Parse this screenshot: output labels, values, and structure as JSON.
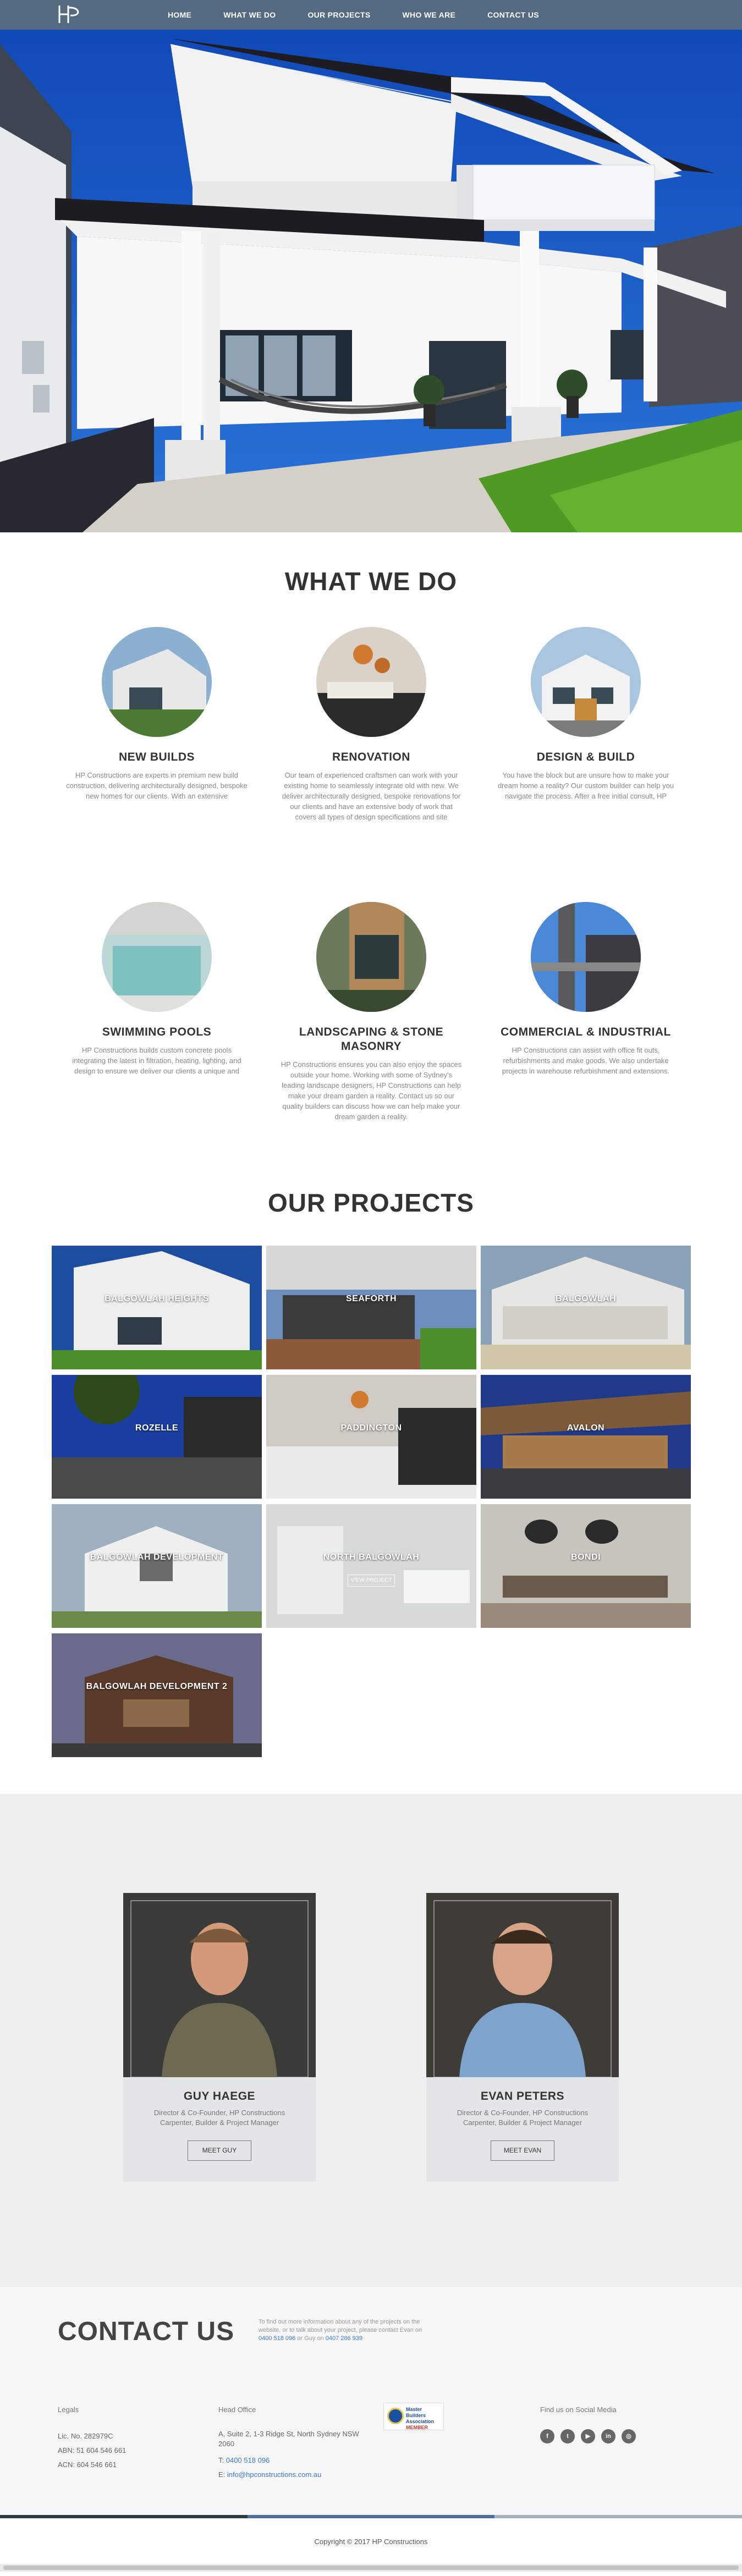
{
  "nav": {
    "logo": "HP",
    "items": [
      "HOME",
      "WHAT WE DO",
      "OUR PROJECTS",
      "WHO WE ARE",
      "CONTACT US"
    ]
  },
  "colors": {
    "nav_bg": "#5a6e7d",
    "stripe_dark": "#2e3b47",
    "stripe_blue": "#4b6f96",
    "stripe_grey": "#a7b4c0",
    "link_blue": "#3a7bd5"
  },
  "what_we_do": {
    "title": "WHAT WE DO",
    "services": [
      {
        "title": "NEW BUILDS",
        "text": "HP Constructions are experts in premium new build construction, delivering architecturally designed, bespoke new homes for our clients. With an extensive"
      },
      {
        "title": "RENOVATION",
        "text": "Our team of experienced craftsmen can work with your existing home to seamlessly integrate old with new. We deliver architecturally designed, bespoke renovations for our clients and have an extensive body of work that covers all types of design specifications and site"
      },
      {
        "title": "DESIGN & BUILD",
        "text": "You have the block but are unsure how to make your dream home a reality? Our custom builder can help you navigate the process. After a free initial consult, HP"
      },
      {
        "title": "SWIMMING POOLS",
        "text": "HP Constructions builds custom concrete pools integrating the latest in filtration, heating, lighting, and design to ensure we deliver our clients a unique and"
      },
      {
        "title": "LANDSCAPING & STONE MASONRY",
        "text": "HP Constructions ensures you can also enjoy the spaces outside your home. Working with some of Sydney's leading landscape designers, HP Constructions can help make your dream garden a reality. Contact us so our quality builders can discuss how we can help make your dream garden a reality."
      },
      {
        "title": "COMMERCIAL & INDUSTRIAL",
        "text": "HP Constructions can assist with office fit outs, refurbishments and make goods. We also undertake projects in warehouse refurbishment and extensions."
      }
    ]
  },
  "projects": {
    "title": "OUR PROJECTS",
    "items": [
      "BALGOWLAH HEIGHTS",
      "SEAFORTH",
      "BALGOWLAH",
      "ROZELLE",
      "PADDINGTON",
      "AVALON",
      "BALGOWLAH DEVELOPMENT",
      "NORTH BALGOWLAH",
      "BONDI",
      "BALGOWLAH DEVELOPMENT 2"
    ],
    "view_label": "VIEW PROJECT"
  },
  "team": {
    "members": [
      {
        "name": "GUY HAEGE",
        "role": "Director & Co-Founder, HP Constructions",
        "trade": "Carpenter, Builder & Project Manager",
        "button": "MEET GUY"
      },
      {
        "name": "EVAN PETERS",
        "role": "Director & Co-Founder, HP Constructions",
        "trade": "Carpenter, Builder & Project Manager",
        "button": "MEET EVAN"
      }
    ]
  },
  "contact": {
    "title": "CONTACT US",
    "intro": "To find out more information about any of the projects on the website, or to talk about your project, please contact Evan on",
    "phone_evan": "0400 518 096",
    "intro_mid": "or Guy on",
    "phone_guy": "0407 286 939",
    "legals_heading": "Legals",
    "lic": "Lic. No. 282979C",
    "abn": "ABN: 51 604 546 661",
    "acn": "ACN: 604 546 661",
    "office_heading": "Head Office",
    "address": "A, Suite 2, 1-3 Ridge St, North Sydney NSW 2060",
    "tel_label": "T:",
    "tel": "0400 518 096",
    "email_label": "E:",
    "email": "info@hpconstructions.com.au",
    "mba_line1": "Master",
    "mba_line2": "Builders",
    "mba_line3": "Association",
    "mba_tag": "MEMBER",
    "social_heading": "Find us on Social Media",
    "social_icons": [
      "facebook-icon",
      "twitter-icon",
      "youtube-icon",
      "linkedin-icon",
      "instagram-icon"
    ]
  },
  "footer": {
    "copyright": "Copyright © 2017 HP Constructions"
  }
}
